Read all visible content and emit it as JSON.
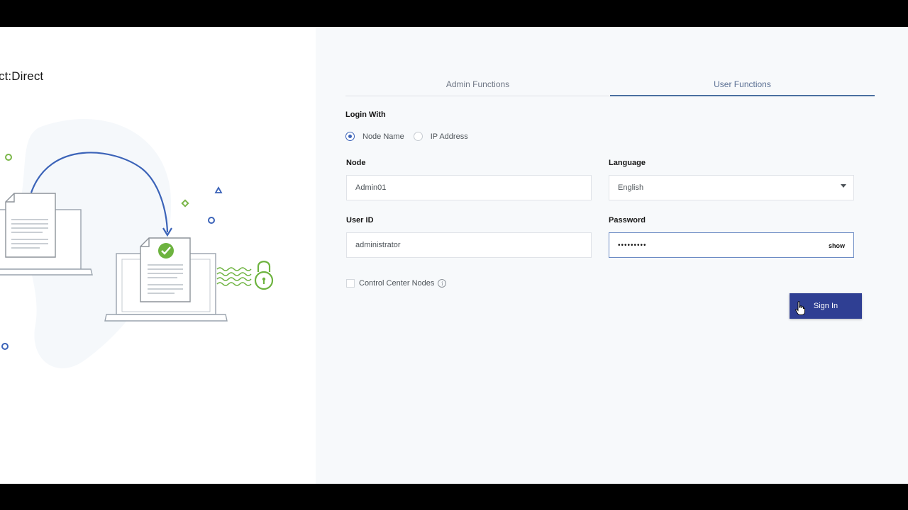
{
  "brand": {
    "title": "ct:Direct"
  },
  "tabs": [
    {
      "label": "Admin Functions",
      "active": false
    },
    {
      "label": "User Functions",
      "active": true
    }
  ],
  "login_with": {
    "label": "Login With",
    "options": [
      {
        "label": "Node Name",
        "selected": true
      },
      {
        "label": "IP Address",
        "selected": false
      }
    ]
  },
  "node": {
    "label": "Node",
    "value": "Admin01"
  },
  "language": {
    "label": "Language",
    "value": "English"
  },
  "user_id": {
    "label": "User ID",
    "value": "administrator"
  },
  "password": {
    "label": "Password",
    "masked_value": "•••••••••",
    "show_label": "show"
  },
  "control_center": {
    "label": "Control Center Nodes",
    "checked": false
  },
  "sign_in": {
    "label": "Sign In"
  },
  "colors": {
    "primary_button": "#2f3f93",
    "tab_active": "#4a6fa0",
    "accent_green": "#6db33f",
    "accent_blue": "#3b63b8"
  }
}
